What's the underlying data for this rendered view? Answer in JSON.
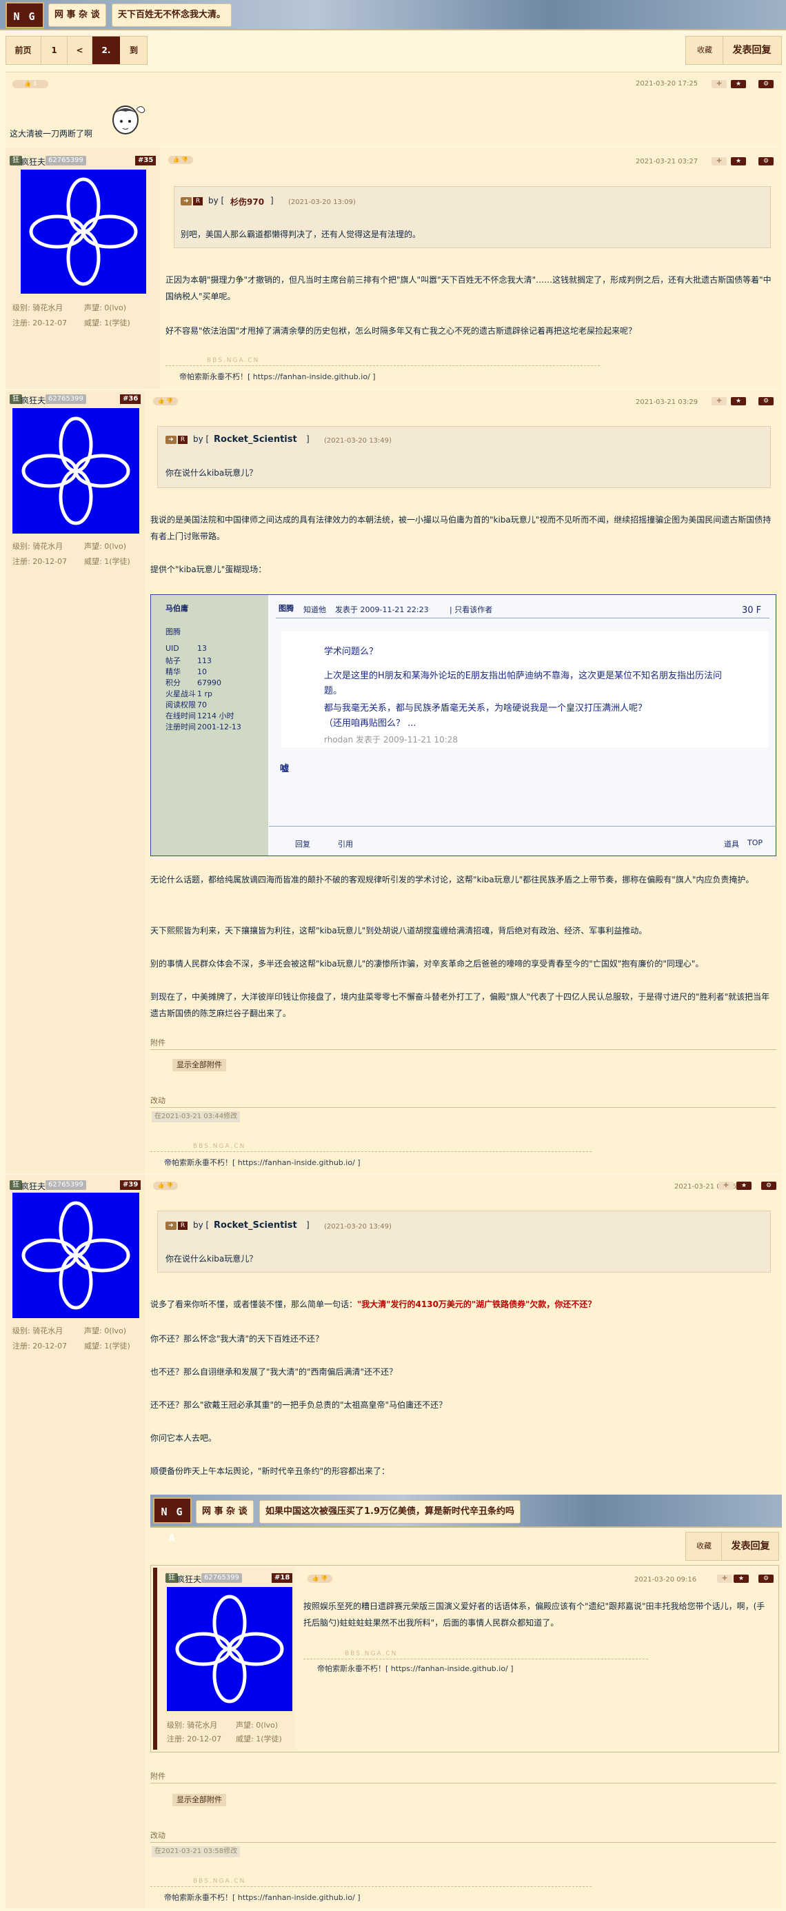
{
  "header": {
    "logo": "N G A",
    "board": "网 事 杂 谈",
    "topic": "天下百姓无不怀念我大清。"
  },
  "pager": {
    "first": "前页",
    "p1": "1",
    "prev": "<",
    "current": "2.",
    "goto": "到"
  },
  "actions": {
    "fav": "收藏",
    "reply": "发表回复"
  },
  "posts": [
    {
      "likes": "3",
      "time": "2021-03-20 17:25",
      "text": "这大清被一刀两断了啊"
    },
    {
      "user": "疯狂夫",
      "badge": "狂",
      "uid": "62765399",
      "floor": "#35",
      "time": "2021-03-21 03:27",
      "level": "级别: 骑花水月",
      "rep": "声望: 0(lvo)",
      "reg": "注册: 20-12-07",
      "prestige": "威望: 1(学徒)",
      "quote_by": "by [",
      "quote_user": "杉伤970",
      "quote_close": "]",
      "quote_time": "(2021-03-20 13:09)",
      "quote_text": "别吧，美国人那么霸道都懒得判决了，还有人觉得这是有法理的。",
      "p1": "正因为本朝\"摄理力争\"才撤销的，但凡当时主席台前三排有个把\"旗人\"叫嚣\"天下百姓无不怀念我大清\"……这钱就搁定了，形成判例之后，还有大批遗古斯国债等着\"中国纳税人\"买单呢。",
      "p2": "好不容易\"依法治国\"才甩掉了满清余孽的历史包袱，怎么时隔多年又有亡我之心不死的遗古斯遗辟徐记着再把这坨老屎捡起来呢？",
      "bbs": "BBS.NGA.CN",
      "sig": "帝帕索斯永垂不朽！[ https://fanhan-inside.github.io/ ]"
    },
    {
      "user": "疯狂夫",
      "badge": "狂",
      "uid": "62765399",
      "floor": "#36",
      "time": "2021-03-21 03:29",
      "level": "级别: 骑花水月",
      "rep": "声望: 0(lvo)",
      "reg": "注册: 20-12-07",
      "prestige": "威望: 1(学徒)",
      "quote_by": "by [",
      "quote_user": "Rocket_Scientist",
      "quote_close": "]",
      "quote_time": "(2021-03-20 13:49)",
      "quote_text": "你在说什么kiba玩意儿？",
      "p1": "我说的是美国法院和中国律师之间达成的具有法律效力的本朝法统，被一小撮以马伯庸为首的\"kiba玩意儿\"视而不见听而不闻，继续招摇撞骗企图为美国民间遗古斯国债持有者上门讨账带路。",
      "p2": "提供个\"kiba玩意儿\"蛋糊现场：",
      "kiba": {
        "name": "马伯庸",
        "label": "图腾",
        "stats": [
          [
            "UID",
            "13"
          ],
          [
            "帖子",
            "113"
          ],
          [
            "精华",
            "10"
          ],
          [
            "积分",
            "67990"
          ],
          [
            "火星战斗",
            "1 rp"
          ],
          [
            "阅读权限",
            "70"
          ],
          [
            "在线时间",
            "1214 小时"
          ],
          [
            "注册时间",
            "2001-12-13"
          ]
        ],
        "head_tag": "图腾",
        "head_a": "知道他",
        "head_b": "发表于 2009-11-21 22:23",
        "head_c": "| 只看该作者",
        "floor": "30 F",
        "q1": "学术问题么？",
        "q2": "上次是这里的H朋友和某海外论坛的E朋友指出帕萨迪纳不靠海，这次更是某位不知名朋友指出历法问题。",
        "q3": "都与我毫无关系，都与民族矛盾毫无关系，为啥硬说我是一个皇汉打压满洲人呢？",
        "q4": "（还用咱再贴图么？ ...",
        "q5": "rhodan 发表于 2009-11-21 10:28",
        "reply": "嘘",
        "f1": "回复",
        "f2": "引用",
        "f3": "道具",
        "f4": "TOP"
      },
      "p3": "无论什么话题，都给纯属放谪四海而皆准的颠扑不破的客观规律听引发的学术讨论，这帮\"kiba玩意儿\"都往民族矛盾之上带节奏，挪称在偏殿有\"旗人\"内应负责掩护。",
      "p4": "天下熙熙皆为利来，天下攘攘皆为利往，这帮\"kiba玩意儿\"到处胡说八道胡搅蛮缠给满清招魂，背后绝对有政治、经济、军事利益推动。",
      "p5": "别的事情人民群众体会不深，多半还会被这帮\"kiba玩意儿\"的凄惨所诈骗，对辛亥革命之后爸爸的嚎啼的享受青春至今的\"亡国奴\"抱有廉价的\"同理心\"。",
      "p6": "到现在了，中美摊牌了，大洋彼岸印钱让你接盘了，境内韭菜零零七不懈奋斗替老外打工了，偏殿\"旗人\"代表了十四亿人民认总服软，于是得寸进尺的\"胜利者\"就该把当年遗古斯国债的陈芝麻烂谷子翻出来了。",
      "att_label": "附件",
      "att_btn": "显示全部附件",
      "edit_label": "改动",
      "edit_text": "在2021-03-21 03:44修改",
      "bbs": "BBS.NGA.CN",
      "sig": "帝帕索斯永垂不朽！[ https://fanhan-inside.github.io/ ]"
    },
    {
      "user": "疯狂夫",
      "badge": "狂",
      "uid": "62765399",
      "floor": "#39",
      "time": "2021-03-21 03:56",
      "level": "级别: 骑花水月",
      "rep": "声望: 0(lvo)",
      "reg": "注册: 20-12-07",
      "prestige": "威望: 1(学徒)",
      "quote_by": "by [",
      "quote_user": "Rocket_Scientist",
      "quote_close": "]",
      "quote_time": "(2021-03-20 13:49)",
      "quote_text": "你在说什么kiba玩意儿？",
      "p1a": "说多了看来你听不懂，或者懂装不懂，那么简单一句话：",
      "p1b": "\"我大清\"发行的4130万美元的\"湖广铁路债券\"欠款，你还不还？",
      "p2": "你不还？那么怀念\"我大清\"的天下百姓还不还？",
      "p3": "也不还？那么自诩继承和发展了\"我大清\"的\"西南偏后满清\"还不还？",
      "p4": "还不还？那么\"欲戴王冠必承其重\"的一把手负总责的\"太祖高皇帝\"马伯庸还不还？",
      "p5": "你问它本人去吧。",
      "p6": "顺便备份昨天上午本坛舆论，\"新时代辛丑条约\"的形容都出来了：",
      "inner": {
        "logo": "N G A",
        "board": "网 事 杂 谈",
        "topic": "如果中国这次被强压买了1.9万亿美债，算是新时代辛丑条约吗",
        "fav": "收藏",
        "reply": "发表回复",
        "user": "疯狂夫",
        "badge": "狂",
        "uid": "62765399",
        "floor": "#18",
        "time": "2021-03-20 09:16",
        "text": "按照娱乐至死的糟日遗辟赛元荣版三国演义爱好者的话语体系，偏殿应该有个\"遗纪\"跟邦嘉说\"田丰托我给您带个话儿，啊，(手托后脑勺)蛀蛀蛀蛀果然不出我所料\"，后面的事情人民群众都知道了。",
        "bbs": "BBS.NGA.CN",
        "sig": "帝帕索斯永垂不朽！[ https://fanhan-inside.github.io/ ]",
        "level": "级别: 骑花水月",
        "rep": "声望: 0(lvo)",
        "reg": "注册: 20-12-07",
        "prestige": "威望: 1(学徒)"
      },
      "att_label": "附件",
      "att_btn": "显示全部附件",
      "edit_label": "改动",
      "edit_text": "在2021-03-21 03:58修改",
      "bbs": "BBS.NGA.CN",
      "sig": "帝帕索斯永垂不朽！[ https://fanhan-inside.github.io/ ]"
    }
  ]
}
